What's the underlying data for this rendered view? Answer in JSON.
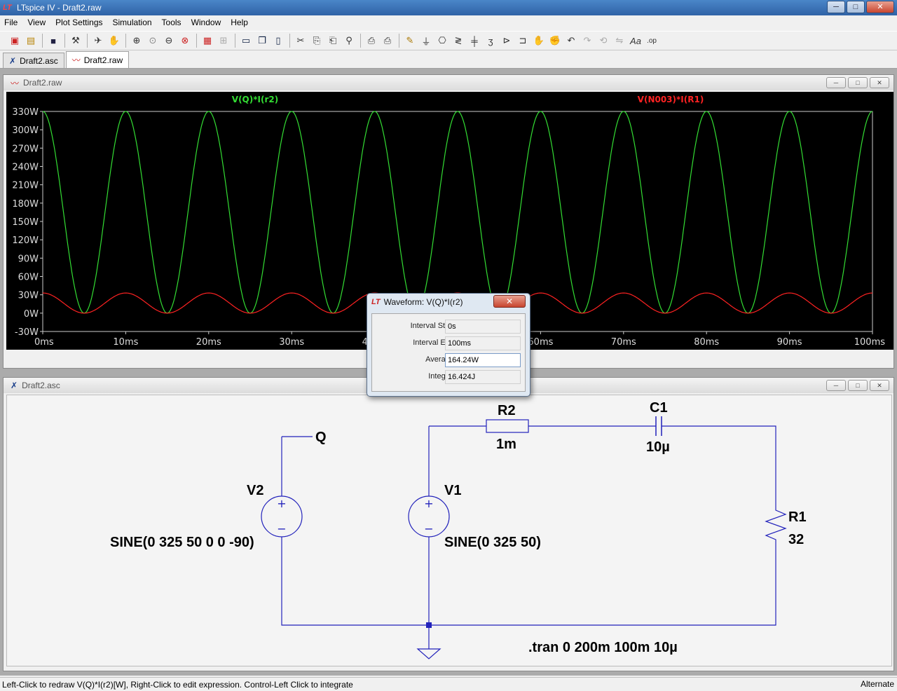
{
  "window": {
    "title": "LTspice IV - Draft2.raw",
    "min": "─",
    "max": "□",
    "close": "✕"
  },
  "menu": [
    "File",
    "View",
    "Plot Settings",
    "Simulation",
    "Tools",
    "Window",
    "Help"
  ],
  "toolbar_icons": [
    "new-schematic-icon",
    "open-icon",
    "save-icon",
    "control-panel-icon",
    "run-icon",
    "pan-icon",
    "zoom-in-icon",
    "zoom-fit-icon",
    "zoom-out-icon",
    "zoom-cancel-icon",
    "autorange-icon",
    "grid-icon",
    "tile-horizontal-icon",
    "cascade-icon",
    "tile-vertical-icon",
    "cut-icon",
    "copy-icon",
    "paste-icon",
    "find-icon",
    "print-setup-icon",
    "print-icon",
    "wire-icon",
    "ground-icon",
    "label-icon",
    "resistor-icon",
    "capacitor-icon",
    "inductor-icon",
    "diode-icon",
    "component-icon",
    "move-icon",
    "drag-icon",
    "undo-icon",
    "redo-icon",
    "rotate-icon",
    "mirror-icon",
    "text-icon",
    "spice-directive-icon"
  ],
  "tabs": [
    {
      "label": "Draft2.asc",
      "icon": "schematic-icon"
    },
    {
      "label": "Draft2.raw",
      "icon": "waveform-icon"
    }
  ],
  "plot_window": {
    "title": "Draft2.raw"
  },
  "schematic_window": {
    "title": "Draft2.asc"
  },
  "chart_data": {
    "type": "line",
    "x_ticks": [
      "0ms",
      "10ms",
      "20ms",
      "30ms",
      "40ms",
      "50ms",
      "60ms",
      "70ms",
      "80ms",
      "90ms",
      "100ms"
    ],
    "y_ticks": [
      "330W",
      "300W",
      "270W",
      "240W",
      "210W",
      "180W",
      "150W",
      "120W",
      "90W",
      "60W",
      "30W",
      "0W",
      "-30W"
    ],
    "xlim": [
      0,
      100
    ],
    "ylim": [
      -30,
      330
    ],
    "series": [
      {
        "name": "V(Q)*I(r2)",
        "color": "#33dd33",
        "amplitude": 330,
        "period_ms": 10,
        "phase_ms": 5,
        "offset": 165,
        "form": "raised_cos"
      },
      {
        "name": "V(N003)*I(R1)",
        "color": "#ff2222",
        "amplitude": 33,
        "period_ms": 10,
        "phase_ms": 5,
        "offset": 16.5,
        "form": "raised_cos"
      }
    ],
    "background": "#000000",
    "grid": false
  },
  "dialog": {
    "title": "Waveform: V(Q)*I(r2)",
    "close": "✕",
    "rows": [
      {
        "label": "Interval Start:",
        "value": "0s"
      },
      {
        "label": "Interval End:",
        "value": "100ms"
      },
      {
        "label": "Average:",
        "value": "164.24W"
      },
      {
        "label": "Integral:",
        "value": "16.424J"
      }
    ]
  },
  "schematic": {
    "v2_name": "V2",
    "v2_value": "SINE(0 325 50 0 0 -90)",
    "q_label": "Q",
    "v1_name": "V1",
    "v1_value": "SINE(0 325 50)",
    "r2_name": "R2",
    "r2_value": "1m",
    "c1_name": "C1",
    "c1_value": "10µ",
    "r1_name": "R1",
    "r1_value": "32",
    "directive": ".tran 0 200m 100m 10µ",
    "plus": "+",
    "minus": "−",
    "wire_color": "#2222bb"
  },
  "status": {
    "left": "Left-Click to redraw V(Q)*I(r2)[W],  Right-Click to edit expression. Control-Left Click to integrate",
    "right": "Alternate"
  }
}
